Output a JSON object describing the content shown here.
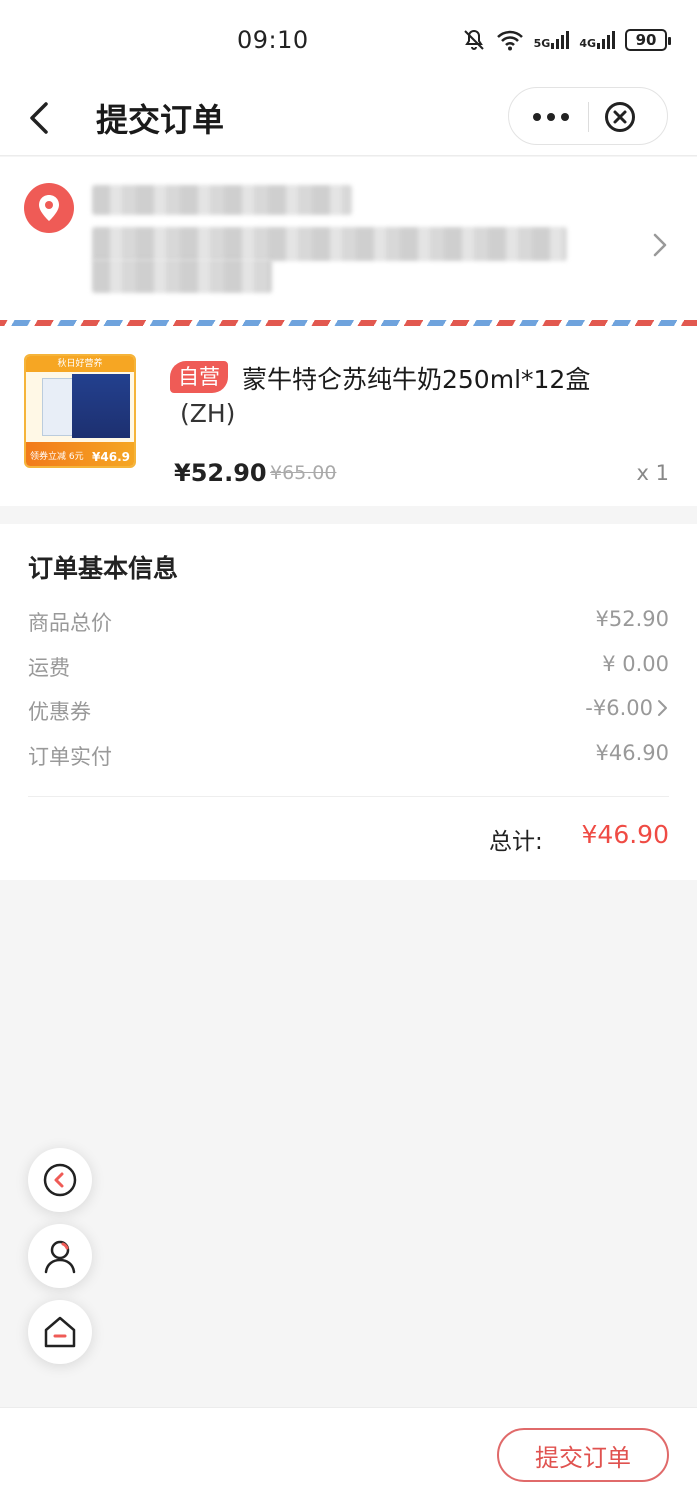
{
  "status_bar": {
    "time": "09:10",
    "signal_1": "5G",
    "signal_2": "4G",
    "battery": "90"
  },
  "nav": {
    "title": "提交订单"
  },
  "product": {
    "self_tag": "自营",
    "name": "蒙牛特仑苏纯牛奶250ml*12盒",
    "sub": "(ZH)",
    "price": "¥52.90",
    "original_price": "¥65.00",
    "quantity": "x 1",
    "image_banner": "秋日好营养",
    "image_promo_text": "领券立减 6元",
    "image_price": "¥46.9"
  },
  "order_info": {
    "title": "订单基本信息",
    "rows": [
      {
        "label": "商品总价",
        "value": "¥52.90"
      },
      {
        "label": "运费",
        "value": "¥ 0.00"
      },
      {
        "label": "优惠券",
        "value": "-¥6.00"
      },
      {
        "label": "订单实付",
        "value": "¥46.90"
      }
    ],
    "total_label": "总计:",
    "total_value": "¥46.90"
  },
  "bottom": {
    "submit_label": "提交订单"
  },
  "colors": {
    "accent_red": "#ef5b56",
    "price_red": "#ef4b44",
    "airmail_blue": "#6fa3dd"
  }
}
